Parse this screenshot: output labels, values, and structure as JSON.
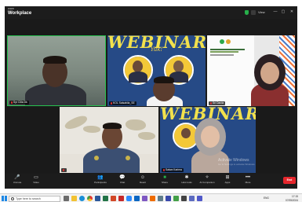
{
  "titlebar": {
    "brand_small": "zoom",
    "app_name": "Workplace",
    "view_label": "View"
  },
  "tiles": {
    "top_left": {
      "name": "Syr Cilla Dk"
    },
    "top_center": {
      "name": "KOL Salsabila_SE",
      "banner_title": "WEBINAR",
      "banner_subtitle": "Yuk!"
    },
    "top_right": {
      "name": "Sri Darda",
      "slide_title": "PROVINSI SUMATERA MEMBANGUN BANGSA"
    },
    "bottom_left": {
      "name": ""
    },
    "bottom_right": {
      "name": "Salwa Karima",
      "banner_title": "WEBINAR"
    }
  },
  "watermark": {
    "title": "Activate Windows",
    "subtitle": "Go to Settings to activate Windows."
  },
  "toolbar": {
    "items": [
      {
        "icon": "mic-icon",
        "glyph": "🎤",
        "label": "Unmute"
      },
      {
        "icon": "video-icon",
        "glyph": "▭",
        "label": "Video"
      },
      {
        "icon": "participants-icon",
        "glyph": "👥",
        "label": "Participants"
      },
      {
        "icon": "chat-icon",
        "glyph": "💬",
        "label": "Chat"
      },
      {
        "icon": "react-icon",
        "glyph": "☺",
        "label": "React"
      },
      {
        "icon": "share-icon",
        "glyph": "■",
        "label": "Share"
      },
      {
        "icon": "host-tools-icon",
        "glyph": "✱",
        "label": "Host tools"
      },
      {
        "icon": "ai-companion-icon",
        "glyph": "✧",
        "label": "AI Companion"
      },
      {
        "icon": "apps-icon",
        "glyph": "⊞",
        "label": "Apps"
      },
      {
        "icon": "more-icon",
        "glyph": "•••",
        "label": "More"
      }
    ],
    "end_label": "End"
  },
  "taskbar": {
    "search_placeholder": "Type here to search",
    "time": "17:15",
    "date": "07/05/2024",
    "language": "ENG"
  },
  "colors": {
    "active_speaker": "#27c250",
    "banner_blue": "#264a86",
    "banner_yellow": "#f2e14c",
    "end_red": "#e5262c",
    "share_green": "#27b04a"
  }
}
